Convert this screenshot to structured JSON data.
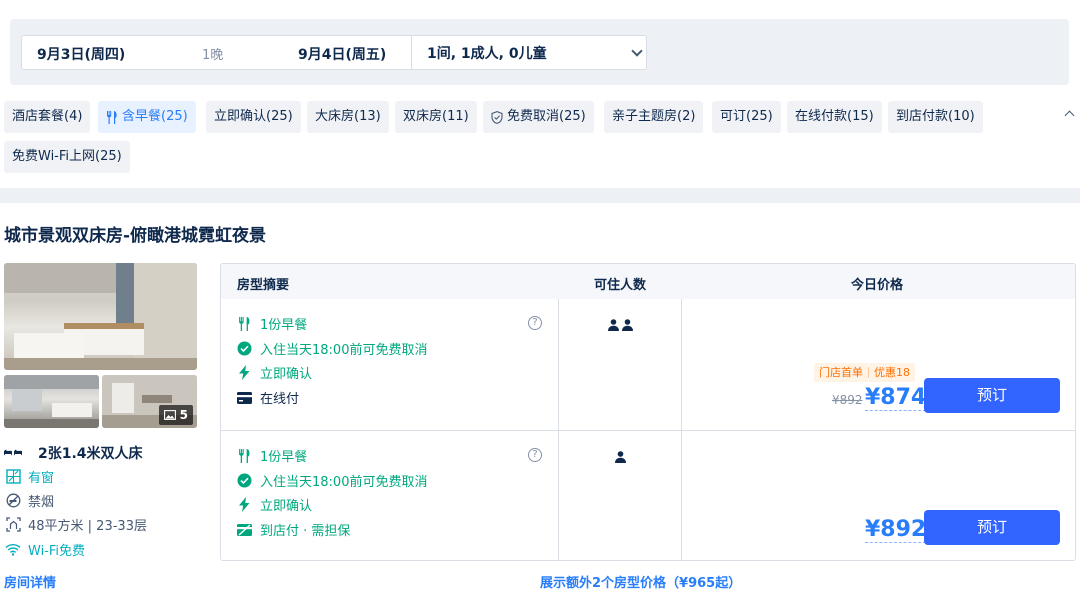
{
  "search": {
    "checkin": "9月3日(周四)",
    "nights": "1晚",
    "checkout": "9月4日(周五)",
    "guests": "1间, 1成人, 0儿童"
  },
  "filters": [
    {
      "label": "酒店套餐(4)",
      "icon": "",
      "active": false
    },
    {
      "label": "含早餐(25)",
      "icon": "utensils-icon",
      "active": true
    },
    {
      "label": "立即确认(25)",
      "icon": "",
      "active": false
    },
    {
      "label": "大床房(13)",
      "icon": "",
      "active": false
    },
    {
      "label": "双床房(11)",
      "icon": "",
      "active": false
    },
    {
      "label": "免费取消(25)",
      "icon": "shield-check-icon",
      "active": false
    },
    {
      "label": "亲子主题房(2)",
      "icon": "",
      "active": false
    },
    {
      "label": "可订(25)",
      "icon": "",
      "active": false
    },
    {
      "label": "在线付款(15)",
      "icon": "",
      "active": false
    },
    {
      "label": "到店付款(10)",
      "icon": "",
      "active": false
    },
    {
      "label": "免费Wi-Fi上网(25)",
      "icon": "",
      "active": false
    }
  ],
  "room": {
    "title": "城市景观双床房-俯瞰港城霓虹夜景",
    "photo_count": "5",
    "bed": "2张1.4米双人床",
    "window": "有窗",
    "smoking": "禁烟",
    "area_floor": "48平方米 | 23-33层",
    "wifi": "Wi-Fi免费",
    "details_link": "房间详情"
  },
  "table": {
    "col_summary": "房型摘要",
    "col_occupancy": "可住人数",
    "col_price": "今日价格"
  },
  "rates": [
    {
      "breakfast": "1份早餐",
      "cancel": "入住当天18:00前可免费取消",
      "confirm": "立即确认",
      "payment": "在线付",
      "occupancy": 2,
      "promo_tag1": "门店首单",
      "promo_tag2": "优惠18",
      "original_price": "¥892",
      "price": "¥874",
      "book_label": "预订"
    },
    {
      "breakfast": "1份早餐",
      "cancel": "入住当天18:00前可免费取消",
      "confirm": "立即确认",
      "payment": "到店付 · 需担保",
      "occupancy": 1,
      "price": "¥892",
      "book_label": "预订"
    }
  ],
  "more_link": "展示额外2个房型价格（¥965起）",
  "colors": {
    "accent": "#287dfa",
    "button": "#3264ff",
    "green": "#06aebd",
    "promo": "#ff6f00"
  }
}
